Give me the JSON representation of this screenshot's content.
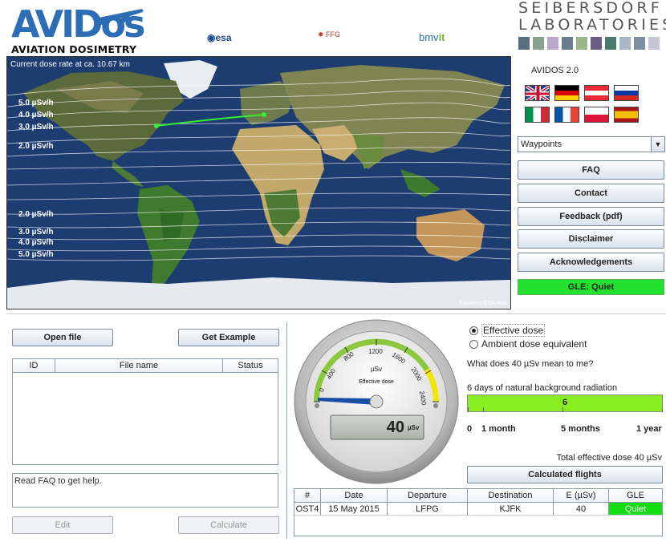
{
  "header": {
    "logo_main": "AVIDos",
    "logo_sub": "AVIATION DOSIMETRY",
    "sponsors": {
      "esa": "esa",
      "ffg": "FFG",
      "bmvit": "bmv",
      "bmvit_suffix": "it"
    },
    "partner_line1": "SEIBERSDORF",
    "partner_line2": "LABORATORIES"
  },
  "map": {
    "caption": "Current dose rate at ca. 10.67 km",
    "courtesy": "Courtesy ESA map",
    "dose_labels_north": [
      "5.0 µSv/h",
      "4.0 µSv/h",
      "3.0 µSv/h",
      "2.0 µSv/h"
    ],
    "dose_labels_south": [
      "2.0 µSv/h",
      "3.0 µSv/h",
      "4.0 µSv/h",
      "5.0 µSv/h"
    ]
  },
  "right_panel": {
    "title": "AVIDOS 2.0",
    "languages": [
      "english-flag-icon",
      "german-flag-icon",
      "austrian-flag-icon",
      "russian-flag-icon",
      "italian-flag-icon",
      "french-flag-icon",
      "polish-flag-icon",
      "spanish-flag-icon"
    ],
    "view_select": "Waypoints",
    "buttons": [
      "FAQ",
      "Contact",
      "Feedback (pdf)",
      "Disclaimer",
      "Acknowledgements"
    ],
    "gle_status": "GLE: Quiet",
    "gle_color": "#22e22e"
  },
  "file_panel": {
    "open_file": "Open file",
    "get_example": "Get Example",
    "columns": [
      "ID",
      "File name",
      "Status"
    ],
    "help_text": "Read FAQ to get help.",
    "edit": "Edit",
    "calculate": "Calculate"
  },
  "gauge": {
    "unit": "µSv",
    "label": "Effective dose",
    "ticks": [
      "0",
      "400",
      "800",
      "1200",
      "1600",
      "2000",
      "2400"
    ],
    "value": "40",
    "value_unit": "µSv"
  },
  "dose_panel": {
    "radio_effective": "Effective dose",
    "radio_ambient": "Ambient dose equivalent",
    "selected": "effective",
    "question": "What does 40 µSv mean to me?",
    "background_text": "6 days of natural background radiation",
    "bar_value": "6",
    "scale_labels": [
      "0",
      "1 month",
      "5 months",
      "1 year"
    ],
    "total": "Total effective dose 40 µSv",
    "calculated_flights": "Calculated flights"
  },
  "flights": {
    "columns": [
      "#",
      "Date",
      "Departure",
      "Destination",
      "E (µSv)",
      "GLE"
    ],
    "rows": [
      [
        "OST4",
        "15 May 2015",
        "LFPG",
        "KJFK",
        "40",
        "Quiet"
      ]
    ]
  }
}
